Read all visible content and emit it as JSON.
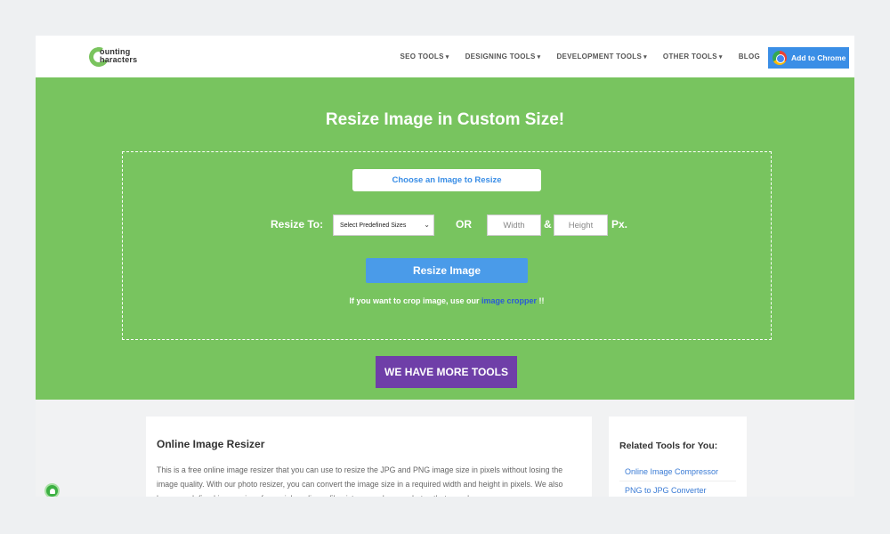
{
  "header": {
    "logo_line1": "ounting",
    "logo_line2": "haracters",
    "nav": [
      {
        "label": "SEO TOOLS",
        "caret": "▾"
      },
      {
        "label": "DESIGNING TOOLS",
        "caret": "▾"
      },
      {
        "label": "DEVELOPMENT TOOLS",
        "caret": "▾"
      },
      {
        "label": "OTHER TOOLS",
        "caret": "▾"
      },
      {
        "label": "BLOG",
        "caret": ""
      }
    ],
    "chrome_button": "Add to Chrome"
  },
  "hero": {
    "title": "Resize Image in Custom Size!",
    "choose_button": "Choose an Image to Resize",
    "resize_label": "Resize To:",
    "select_value": "Select Predefined Sizes",
    "or_label": "OR",
    "width_placeholder": "Width",
    "amp_label": "&",
    "height_placeholder": "Height",
    "px_label": "Px.",
    "resize_button": "Resize Image",
    "crop_note_prefix": "If you want to crop image, use our ",
    "crop_link": "image cropper",
    "crop_note_suffix": " !!",
    "more_tools_button": "WE HAVE MORE TOOLS"
  },
  "article": {
    "title": "Online Image Resizer",
    "body": "This is a free online image resizer that you can use to resize the JPG and PNG image size in pixels without losing the image quality. With our photo resizer, you can convert the image size in a required width and height in pixels. We also have pre-defined image sizes for social media profile pictures and cover photos that you choose"
  },
  "related": {
    "title": "Related Tools for You:",
    "items": [
      "Online Image Compressor",
      "PNG to JPG Converter"
    ]
  },
  "colors": {
    "hero_green": "#78c45f",
    "chrome_blue": "#3a8ee6",
    "more_tools_purple": "#6f3fa8",
    "link_blue": "#3a7bd5"
  },
  "icons": {
    "logo": "counting-characters-logo",
    "chrome": "chrome-icon",
    "bell": "notification-bell-icon"
  }
}
